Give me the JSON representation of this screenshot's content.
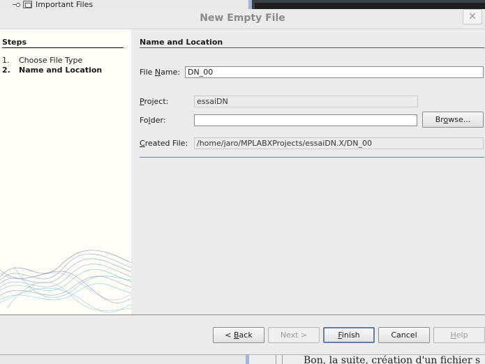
{
  "background": {
    "tree_item_label": "Important Files",
    "bottom_text": "Bon, la suite, création d'un fichier s"
  },
  "dialog": {
    "title": "New Empty File",
    "close_glyph": "✕"
  },
  "steps": {
    "heading": "Steps",
    "items": [
      {
        "num": "1.",
        "label": "Choose File Type"
      },
      {
        "num": "2.",
        "label": "Name and Location"
      }
    ],
    "current_index": 1
  },
  "form": {
    "section_title": "Name and Location",
    "file_name": {
      "label_pre": "File ",
      "label_mn": "N",
      "label_post": "ame:",
      "value": "DN_00"
    },
    "project": {
      "label_mn": "P",
      "label_post": "roject:",
      "value": "essaiDN"
    },
    "folder": {
      "label_pre": "Fo",
      "label_mn": "l",
      "label_post": "der:",
      "value": ""
    },
    "browse": {
      "label_pre": "Br",
      "label_mn": "o",
      "label_post": "wse..."
    },
    "created_file": {
      "label_mn": "C",
      "label_post": "reated File:",
      "value": "/home/jaro/MPLABXProjects/essaiDN.X/DN_00"
    }
  },
  "buttons": {
    "back": {
      "pre": "< ",
      "mn": "B",
      "post": "ack"
    },
    "next": {
      "label": "Next >"
    },
    "finish": {
      "mn": "F",
      "post": "inish"
    },
    "cancel": {
      "label": "Cancel"
    },
    "help": {
      "mn": "H",
      "post": "elp"
    }
  }
}
